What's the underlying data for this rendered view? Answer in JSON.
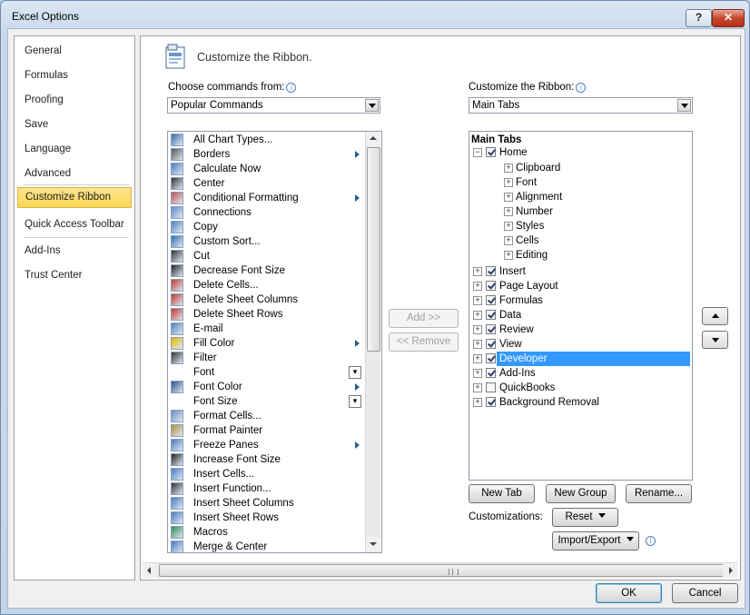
{
  "window": {
    "title": "Excel Options",
    "help_label": "?",
    "close_label": "✕"
  },
  "nav": {
    "items": [
      {
        "label": "General"
      },
      {
        "label": "Formulas"
      },
      {
        "label": "Proofing"
      },
      {
        "label": "Save"
      },
      {
        "label": "Language"
      },
      {
        "label": "Advanced"
      },
      {
        "label": "Customize Ribbon",
        "selected": true
      },
      {
        "label": "Quick Access Toolbar"
      },
      {
        "label": "Add-Ins"
      },
      {
        "label": "Trust Center"
      }
    ]
  },
  "header": {
    "title": "Customize the Ribbon.",
    "icon": "customize-ribbon-icon"
  },
  "left": {
    "choose_label": "Choose commands from:",
    "choose_value": "Popular Commands",
    "commands": [
      {
        "label": "All Chart Types...",
        "icon": "chart-icon"
      },
      {
        "label": "Borders",
        "icon": "borders-icon",
        "submenu": true
      },
      {
        "label": "Calculate Now",
        "icon": "calculator-icon"
      },
      {
        "label": "Center",
        "icon": "align-center-icon"
      },
      {
        "label": "Conditional Formatting",
        "icon": "conditional-formatting-icon",
        "submenu": true
      },
      {
        "label": "Connections",
        "icon": "connections-icon"
      },
      {
        "label": "Copy",
        "icon": "copy-icon"
      },
      {
        "label": "Custom Sort...",
        "icon": "sort-icon"
      },
      {
        "label": "Cut",
        "icon": "scissors-icon"
      },
      {
        "label": "Decrease Font Size",
        "icon": "font-decrease-icon"
      },
      {
        "label": "Delete Cells...",
        "icon": "delete-cells-icon"
      },
      {
        "label": "Delete Sheet Columns",
        "icon": "delete-columns-icon"
      },
      {
        "label": "Delete Sheet Rows",
        "icon": "delete-rows-icon"
      },
      {
        "label": "E-mail",
        "icon": "email-icon"
      },
      {
        "label": "Fill Color",
        "icon": "fill-color-icon",
        "submenu": true
      },
      {
        "label": "Filter",
        "icon": "filter-icon"
      },
      {
        "label": "Font",
        "icon": "",
        "split": true
      },
      {
        "label": "Font Color",
        "icon": "font-color-icon",
        "submenu": true
      },
      {
        "label": "Font Size",
        "icon": "",
        "split": true
      },
      {
        "label": "Format Cells...",
        "icon": "format-cells-icon"
      },
      {
        "label": "Format Painter",
        "icon": "format-painter-icon"
      },
      {
        "label": "Freeze Panes",
        "icon": "freeze-panes-icon",
        "submenu": true
      },
      {
        "label": "Increase Font Size",
        "icon": "font-increase-icon"
      },
      {
        "label": "Insert Cells...",
        "icon": "insert-cells-icon"
      },
      {
        "label": "Insert Function...",
        "icon": "function-icon"
      },
      {
        "label": "Insert Sheet Columns",
        "icon": "insert-columns-icon"
      },
      {
        "label": "Insert Sheet Rows",
        "icon": "insert-rows-icon"
      },
      {
        "label": "Macros",
        "icon": "macros-icon"
      },
      {
        "label": "Merge & Center",
        "icon": "merge-center-icon"
      }
    ]
  },
  "middle": {
    "add_label": "Add >>",
    "remove_label": "<< Remove"
  },
  "right": {
    "customize_label": "Customize the Ribbon:",
    "customize_value": "Main Tabs",
    "tree_header": "Main Tabs",
    "home": {
      "label": "Home",
      "checked": true,
      "groups": [
        "Clipboard",
        "Font",
        "Alignment",
        "Number",
        "Styles",
        "Cells",
        "Editing"
      ]
    },
    "tabs": [
      {
        "label": "Insert",
        "checked": true
      },
      {
        "label": "Page Layout",
        "checked": true
      },
      {
        "label": "Formulas",
        "checked": true
      },
      {
        "label": "Data",
        "checked": true
      },
      {
        "label": "Review",
        "checked": true
      },
      {
        "label": "View",
        "checked": true
      },
      {
        "label": "Developer",
        "checked": true,
        "selected": true
      },
      {
        "label": "Add-Ins",
        "checked": true
      },
      {
        "label": "QuickBooks",
        "checked": false
      },
      {
        "label": "Background Removal",
        "checked": true
      }
    ],
    "new_tab_label": "New Tab",
    "new_group_label": "New Group",
    "rename_label": "Rename...",
    "customizations_label": "Customizations:",
    "reset_label": "Reset",
    "import_export_label": "Import/Export"
  },
  "footer": {
    "ok_label": "OK",
    "cancel_label": "Cancel",
    "scroll_grip": "III"
  },
  "colors": {
    "selection": "#3399ff",
    "nav_selected": "#fbd656",
    "title_bar": "#c8d8ec"
  }
}
